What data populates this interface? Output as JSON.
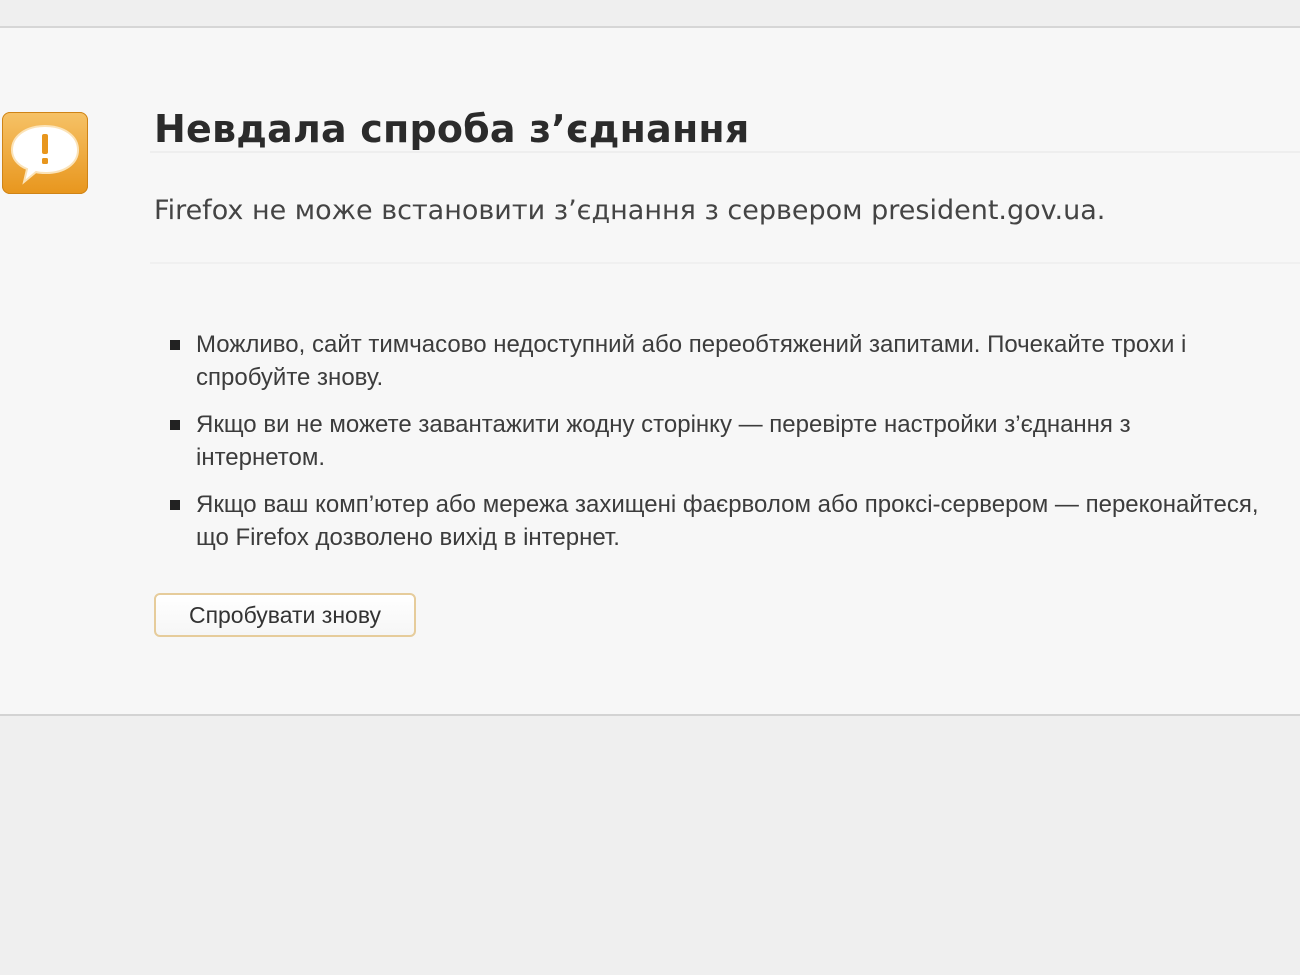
{
  "error": {
    "icon": "speech-bubble-alert-icon",
    "title": "Невдала спроба з’єднання",
    "description": "Firefox не може встановити з’єднання з сервером president.gov.ua.",
    "reasons": [
      "Можливо, сайт тимчасово недоступний або переобтяжений запитами. Почекайте трохи і спробуйте знову.",
      "Якщо ви не можете завантажити жодну сторінку — перевірте настройки з’єднання з інтернетом.",
      "Якщо ваш комп’ютер або мережа захищені фаєрволом або проксі-сервером — переконайтеся, що Firefox дозволено вихід в інтернет."
    ],
    "retry_label": "Спробувати знову"
  },
  "colors": {
    "icon_orange": "#f0a838",
    "title_text": "#2b2b2b",
    "button_border": "#e6cc9b"
  }
}
